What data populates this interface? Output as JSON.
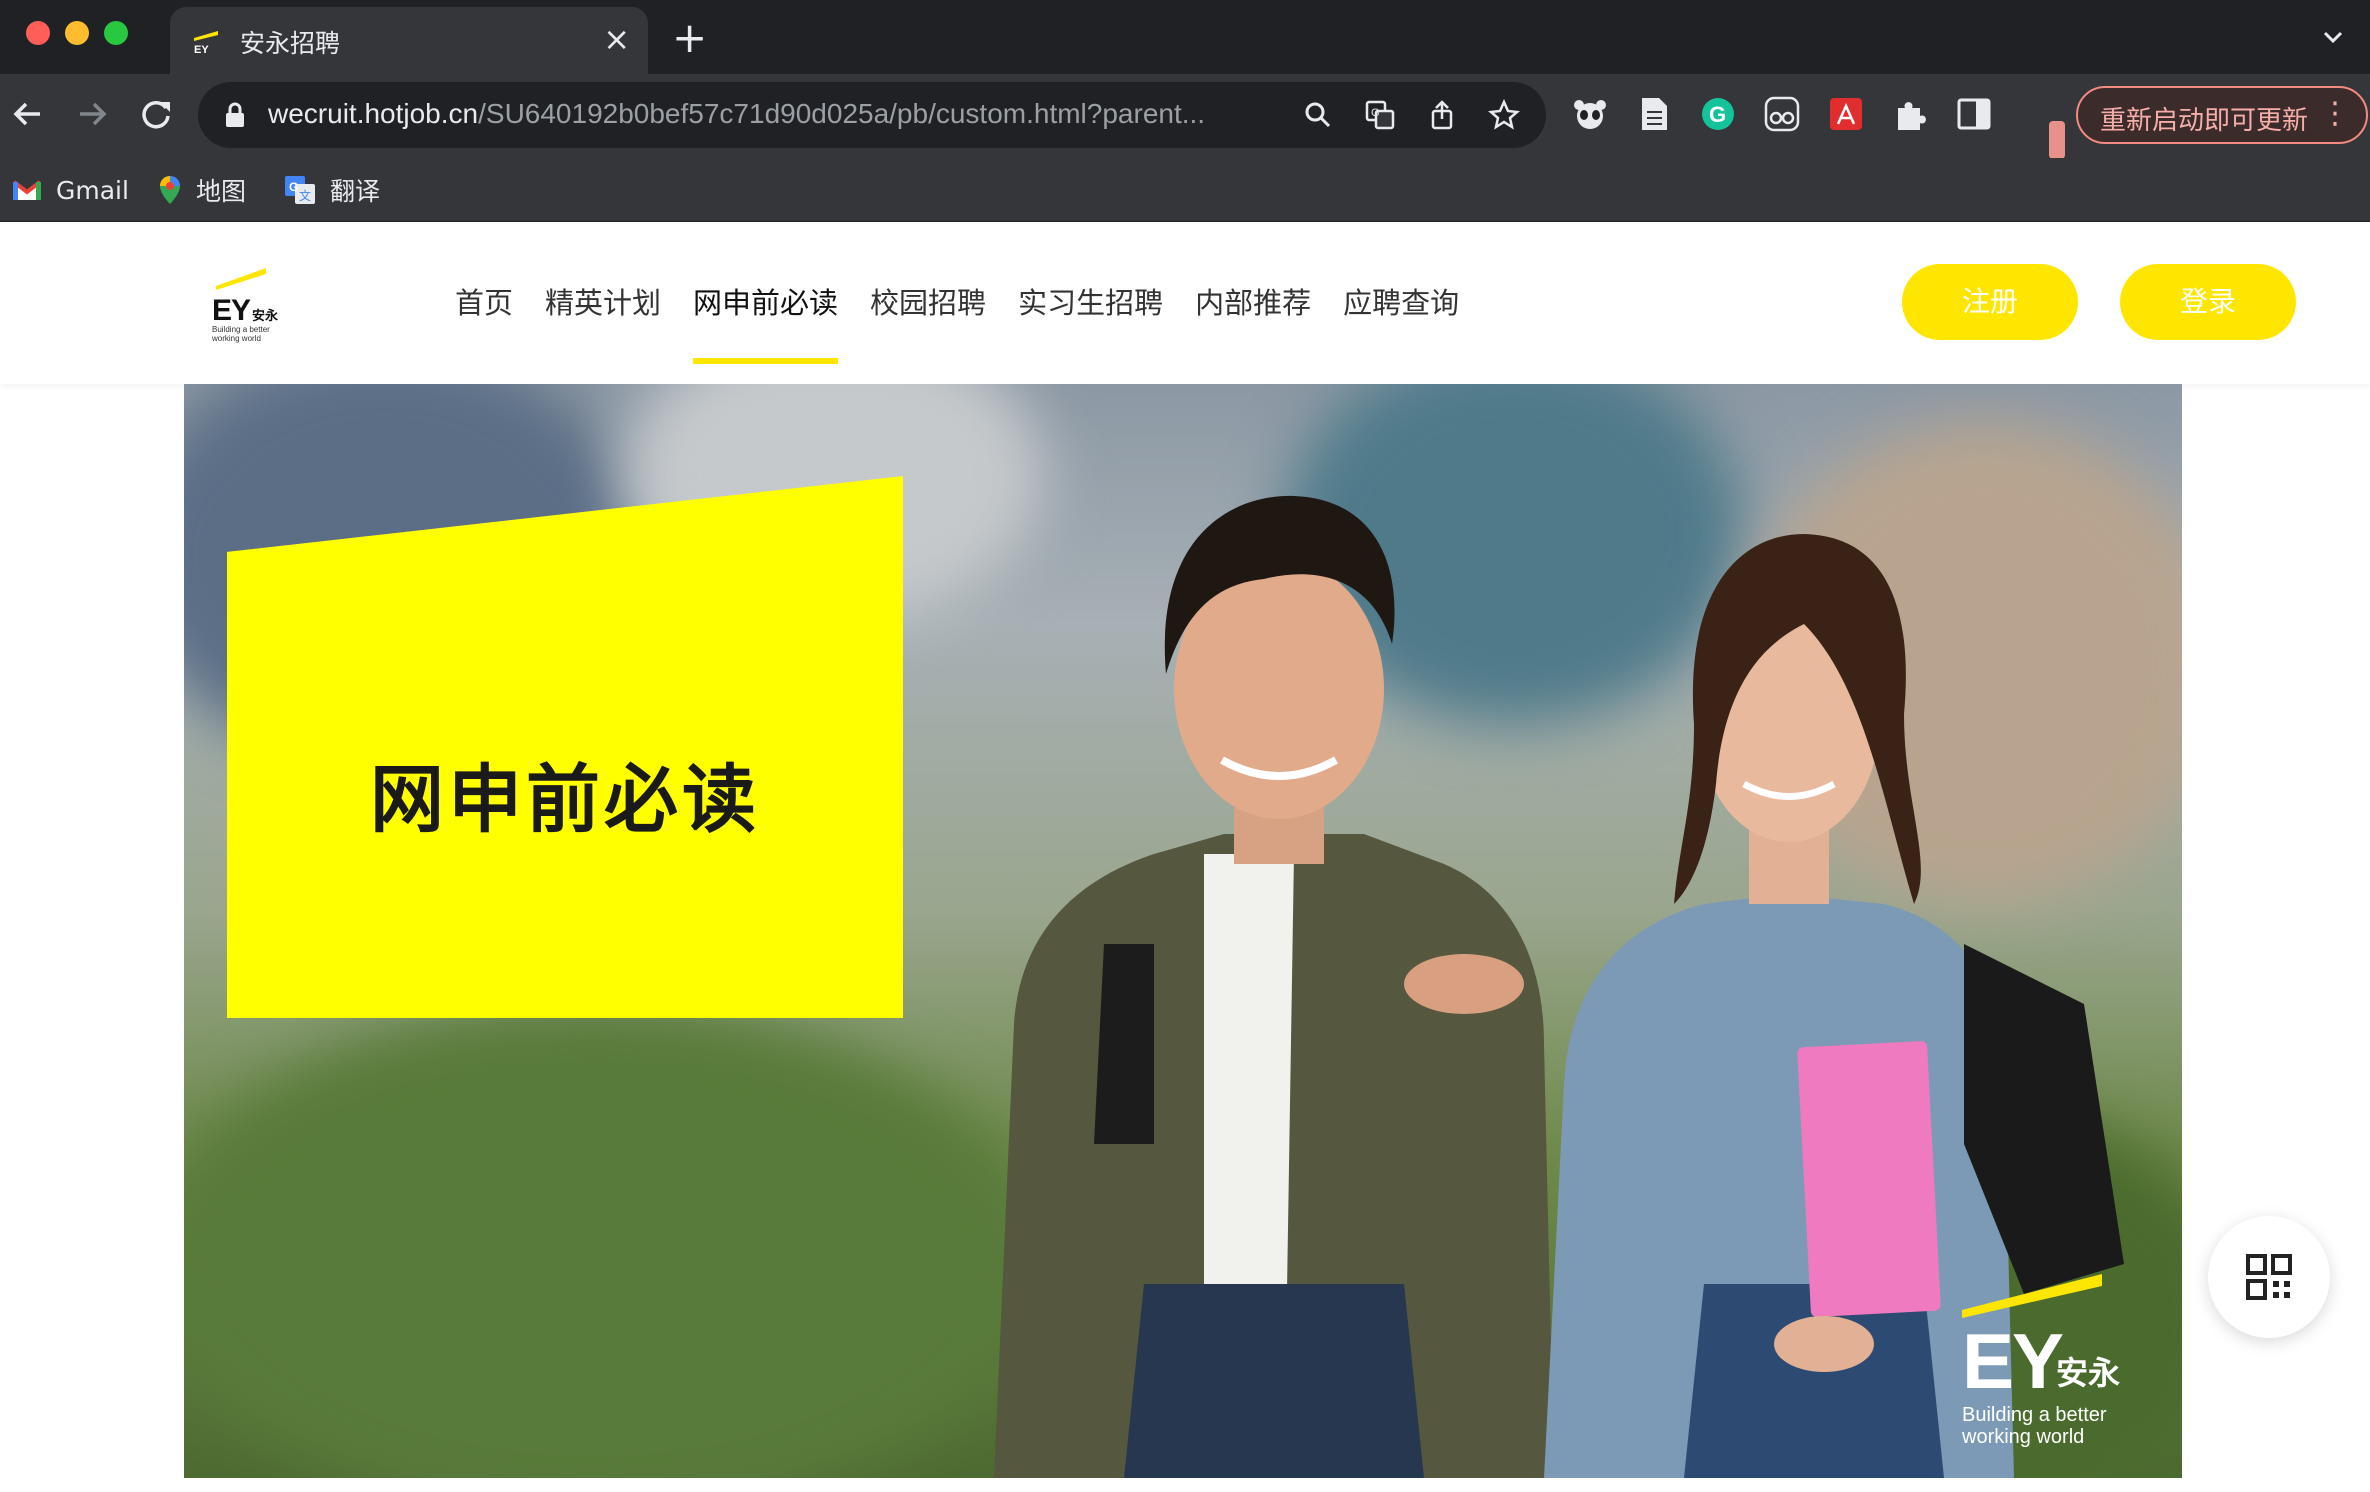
{
  "browser": {
    "tab_title": "安永招聘",
    "url_host": "wecruit.hotjob.cn",
    "url_path": "/SU640192b0bef57c71d90d025a/pb/custom.html?parent...",
    "update_button": "重新启动即可更新",
    "bookmarks": [
      {
        "label": "Gmail",
        "icon": "gmail-icon"
      },
      {
        "label": "地图",
        "icon": "maps-icon"
      },
      {
        "label": "翻译",
        "icon": "translate-icon"
      }
    ]
  },
  "site": {
    "logo_text": "EY",
    "logo_cn": "安永",
    "logo_tagline_1": "Building a better",
    "logo_tagline_2": "working world",
    "nav": [
      {
        "label": "首页",
        "active": false
      },
      {
        "label": "精英计划",
        "active": false
      },
      {
        "label": "网申前必读",
        "active": true
      },
      {
        "label": "校园招聘",
        "active": false
      },
      {
        "label": "实习生招聘",
        "active": false
      },
      {
        "label": "内部推荐",
        "active": false
      },
      {
        "label": "应聘查询",
        "active": false
      }
    ],
    "register_label": "注册",
    "login_label": "登录",
    "accent_color": "#ffe600"
  },
  "hero": {
    "title": "网申前必读",
    "brand": "EY",
    "brand_cn": "安永",
    "tagline_1": "Building a better",
    "tagline_2": "working world"
  }
}
